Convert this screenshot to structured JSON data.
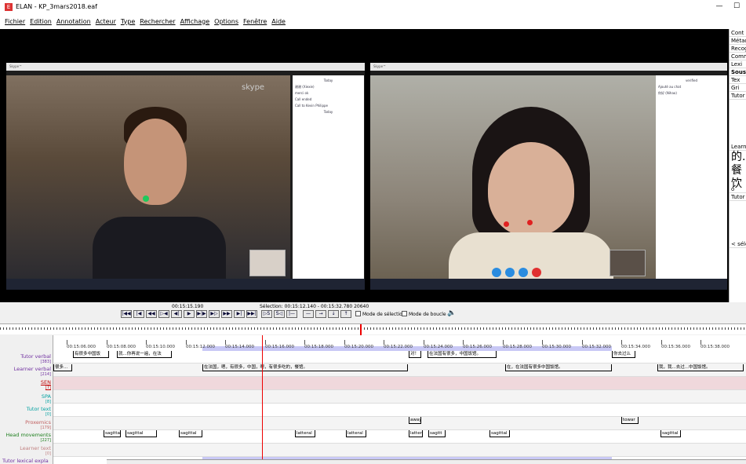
{
  "window": {
    "title": "ELAN - KP_3mars2018.eaf",
    "minimize": "—",
    "maximize": "☐"
  },
  "menu": [
    "Fichier",
    "Edition",
    "Annotation",
    "Acteur",
    "Type",
    "Rechercher",
    "Affichage",
    "Options",
    "Fenêtre",
    "Aide"
  ],
  "right_panel": {
    "items": [
      "Cont",
      "Métad",
      "Recog",
      "Comm",
      "Lexi",
      "Sous-",
      "Tex",
      "Gri",
      "Tutor"
    ],
    "learner_label": "Learne",
    "chars": [
      "的...",
      "餐饮"
    ],
    "o_label": "o",
    "tutor_label": "Tutor",
    "select_label": "< séle"
  },
  "video": {
    "left_chat": [
      "Today",
      "谢谢 (Xiexie)",
      "merci ok",
      "Call ended",
      "Call to Kevin Philippe",
      "Today"
    ],
    "right_chat": [
      "verified",
      "Ajouté au chat",
      "你好 (Nihao)"
    ],
    "skype_logo": "skype"
  },
  "controls": {
    "time": "00:15:15.190",
    "selection": "Sélection: 00:15:12.140 - 00:15:32.780  20640",
    "selection_mode_label": "Mode de sélection",
    "loop_mode_label": "Mode de boucle",
    "buttons_left": [
      "|◀◀",
      "|◀",
      "◀◀",
      "▷◀",
      "◀|",
      "▶",
      "▶|▶",
      "▶▷",
      "▶▶",
      "▶|",
      "▶▶|"
    ],
    "buttons_mid": [
      "▷S",
      "S◁",
      "|—"
    ],
    "buttons_right": [
      "—",
      "→",
      "↓",
      "↑"
    ]
  },
  "timeline": {
    "ticks": [
      "00:15:06.000",
      "00:15:08.000",
      "00:15:10.000",
      "00:15:12.000",
      "00:15:14.000",
      "00:15:16.000",
      "00:15:18.000",
      "00:15:20.000",
      "00:15:22.000",
      "00:15:24.000",
      "00:15:26.000",
      "00:15:28.000",
      "00:15:30.000",
      "00:15:32.000",
      "00:15:34.000",
      "00:15:36.000",
      "00:15:38.000"
    ]
  },
  "tiers": [
    {
      "name": "Tutor verbal",
      "count": "[383]",
      "color": "#7030a0"
    },
    {
      "name": "Learner verbal",
      "count": "[214]",
      "color": "#7030a0"
    },
    {
      "name": "SEN",
      "count": "[7]",
      "color": "#c00000"
    },
    {
      "name": "SPA",
      "count": "[8]",
      "color": "#00a0a0"
    },
    {
      "name": "Tutor text",
      "count": "[0]",
      "color": "#00a0a0"
    },
    {
      "name": "Proxemics",
      "count": "[179]",
      "color": "#c06060"
    },
    {
      "name": "Head movements",
      "count": "[227]",
      "color": "#208020"
    },
    {
      "name": "Learner text",
      "count": "[0]",
      "color": "#c08080"
    },
    {
      "name": "Tutor lexical expla",
      "count": "",
      "color": "#7030a0"
    }
  ],
  "annotations": {
    "tutor_verbal": [
      "有很多中国饭",
      "就...你再说一遍，在法",
      "对！",
      "在法国有很多，中国饭馆。",
      "在法国有很多中国饭馆。",
      "你去过么"
    ],
    "learner_verbal": [
      "很多...",
      "在法国，嗯，有很多，中国，嗯，有很多吃的，餐馆。",
      "在，在法国有很多中国饭馆。",
      "我，我...去过...中国饭馆。"
    ],
    "proxemics": [
      "away",
      "towar"
    ],
    "head_movements": [
      "sagitta",
      "sagittal",
      "sagittal",
      "latteral",
      "latteral",
      "latter",
      "sagitt",
      "sagittal",
      "sagittal"
    ]
  }
}
